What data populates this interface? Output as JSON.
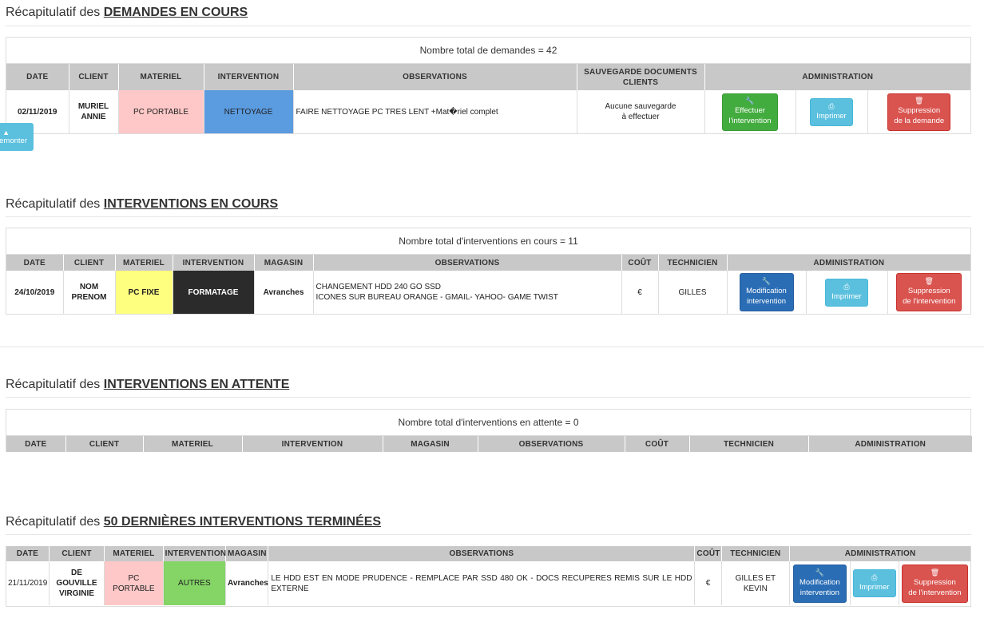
{
  "sections": {
    "demandes": {
      "prefix": "Récapitulatif des",
      "title": "DEMANDES EN COURS",
      "total": "Nombre total de demandes = 42",
      "headers": [
        "DATE",
        "CLIENT",
        "MATERIEL",
        "INTERVENTION",
        "OBSERVATIONS",
        "SAUVEGARDE DOCUMENTS CLIENTS",
        "ADMINISTRATION"
      ],
      "row": {
        "date": "02/11/2019",
        "client_line1": "MURIEL",
        "client_line2": "ANNIE",
        "materiel": "PC PORTABLE",
        "intervention": "NETTOYAGE",
        "observations": "FAIRE NETTOYAGE PC TRES LENT +Mat�riel complet",
        "sauvegarde_line1": "Aucune sauvegarde",
        "sauvegarde_line2": "à effectuer",
        "btn1_line1": "Effectuer",
        "btn1_line2": "l'intervention",
        "btn2": "Imprimer",
        "btn3_line1": "Suppression",
        "btn3_line2": "de la demande"
      }
    },
    "encours": {
      "prefix": "Récapitulatif des",
      "title": "INTERVENTIONS EN COURS",
      "total": "Nombre total d'interventions en cours = 11",
      "headers": [
        "DATE",
        "CLIENT",
        "MATERIEL",
        "INTERVENTION",
        "MAGASIN",
        "OBSERVATIONS",
        "COÛT",
        "TECHNICIEN",
        "ADMINISTRATION"
      ],
      "row": {
        "date": "24/10/2019",
        "client_line1": "NOM",
        "client_line2": "PRENOM",
        "materiel": "PC FIXE",
        "intervention": "FORMATAGE",
        "magasin": "Avranches",
        "obs_line1": "CHANGEMENT HDD 240 GO SSD",
        "obs_line2": "ICONES SUR BUREAU ORANGE - GMAIL- YAHOO- GAME TWIST",
        "cout": "€",
        "technicien": "GILLES",
        "btn1_line1": "Modification",
        "btn1_line2": "intervention",
        "btn2": "Imprimer",
        "btn3_line1": "Suppression",
        "btn3_line2": "de l'intervention"
      }
    },
    "attente": {
      "prefix": "Récapitulatif des",
      "title": "INTERVENTIONS EN ATTENTE",
      "total": "Nombre total d'interventions en attente = 0",
      "headers": [
        "DATE",
        "CLIENT",
        "MATERIEL",
        "INTERVENTION",
        "MAGASIN",
        "OBSERVATIONS",
        "COÛT",
        "TECHNICIEN",
        "ADMINISTRATION"
      ]
    },
    "terminees": {
      "prefix": "Récapitulatif des",
      "title": "50 DERNIÈRES INTERVENTIONS TERMINÉES",
      "headers": [
        "DATE",
        "CLIENT",
        "MATERIEL",
        "INTERVENTION",
        "MAGASIN",
        "OBSERVATIONS",
        "COÛT",
        "TECHNICIEN",
        "ADMINISTRATION"
      ],
      "row": {
        "date": "21/11/2019",
        "client_line1": "DE",
        "client_line2": "GOUVILLE",
        "client_line3": "VIRGINIE",
        "materiel_line1": "PC",
        "materiel_line2": "PORTABLE",
        "intervention": "AUTRES",
        "magasin": "Avranches",
        "observations": "LE HDD EST EN MODE PRUDENCE - REMPLACE PAR SSD 480 OK - DOCS RECUPERES REMIS SUR LE HDD EXTERNE",
        "cout": "€",
        "tech_line1": "GILLES ET",
        "tech_line2": "KEVIN",
        "btn1_line1": "Modification",
        "btn1_line2": "intervention",
        "btn2": "Imprimer",
        "btn3_line1": "Suppression",
        "btn3_line2": "de l'intervention"
      }
    }
  },
  "remonter": "Remonter",
  "icons": {
    "wrench": "wrench-icon",
    "print": "print-icon",
    "trash": "trash-icon",
    "up": "up-icon"
  }
}
